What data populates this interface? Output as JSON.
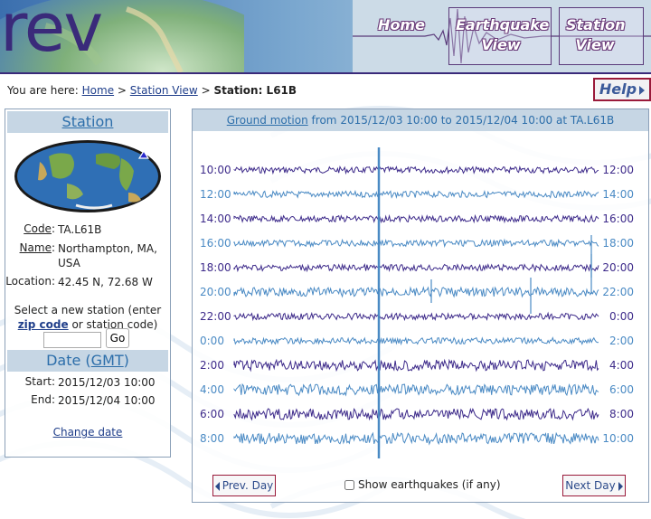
{
  "app": {
    "logo": "rev"
  },
  "nav": [
    {
      "label": "Home"
    },
    {
      "label": "Earthquake View"
    },
    {
      "label": "Station View"
    }
  ],
  "breadcrumb": {
    "prefix": "You are here:",
    "home": "Home",
    "sep1": ">",
    "station_view": "Station View",
    "sep2": ">",
    "current": "Station: L61B"
  },
  "help": {
    "label": "Help"
  },
  "sidebar": {
    "station_heading": "Station",
    "code_label": "Code",
    "code_value": "TA.L61B",
    "name_label": "Name",
    "name_value": "Northampton, MA, USA",
    "location_label": "Location:",
    "location_value": "42.45 N, 72.68 W",
    "select_text_1": "Select a new station (enter",
    "select_link": "zip code",
    "select_text_2": "or station code)",
    "zip_value": "",
    "go_label": "Go",
    "date_heading_prefix": "Date (",
    "date_heading_link": "GMT",
    "date_heading_suffix": ")",
    "start_label": "Start:",
    "start_value": "2015/12/03 10:00",
    "end_label": "End:",
    "end_value": "2015/12/04 10:00",
    "change_date": "Change date"
  },
  "main": {
    "title_link": "Ground motion",
    "title_from": "from",
    "title_start": "2015/12/03 10:00",
    "title_to": "to",
    "title_end": "2015/12/04 10:00",
    "title_at": "at TA.L61B",
    "prev_day": "Prev. Day",
    "next_day": "Next Day",
    "show_earthquakes": "Show earthquakes (if any)",
    "show_earthquakes_checked": false
  },
  "chart_data": {
    "type": "line",
    "rows": [
      {
        "left": "10:00",
        "right": "12:00"
      },
      {
        "left": "12:00",
        "right": "14:00"
      },
      {
        "left": "14:00",
        "right": "16:00"
      },
      {
        "left": "16:00",
        "right": "18:00"
      },
      {
        "left": "18:00",
        "right": "20:00"
      },
      {
        "left": "20:00",
        "right": "22:00"
      },
      {
        "left": "22:00",
        "right": "0:00"
      },
      {
        "left": "0:00",
        "right": "2:00"
      },
      {
        "left": "2:00",
        "right": "4:00"
      },
      {
        "left": "4:00",
        "right": "6:00"
      },
      {
        "left": "6:00",
        "right": "8:00"
      },
      {
        "left": "8:00",
        "right": "10:00"
      }
    ],
    "colors": [
      "#3d2a8a",
      "#4a8ac4"
    ]
  }
}
